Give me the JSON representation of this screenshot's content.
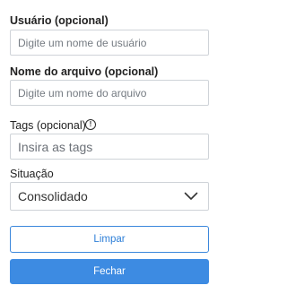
{
  "form": {
    "username": {
      "label": "Usuário (opcional)",
      "placeholder": "Digite um nome de usuário",
      "value": ""
    },
    "filename": {
      "label": "Nome do arquivo (opcional)",
      "placeholder": "Digite um nome do arquivo",
      "value": ""
    },
    "tags": {
      "label": "Tags (opcional)",
      "info_icon": "info-icon",
      "info_glyph": "!",
      "placeholder": "Insira as tags",
      "value": ""
    },
    "status": {
      "label": "Situação",
      "selected": "Consolidado",
      "icon": "chevron-down-icon"
    }
  },
  "buttons": {
    "clear_label": "Limpar",
    "close_label": "Fechar"
  },
  "colors": {
    "accent": "#3d8be2",
    "border": "#cfd3d8",
    "text": "#222222"
  }
}
